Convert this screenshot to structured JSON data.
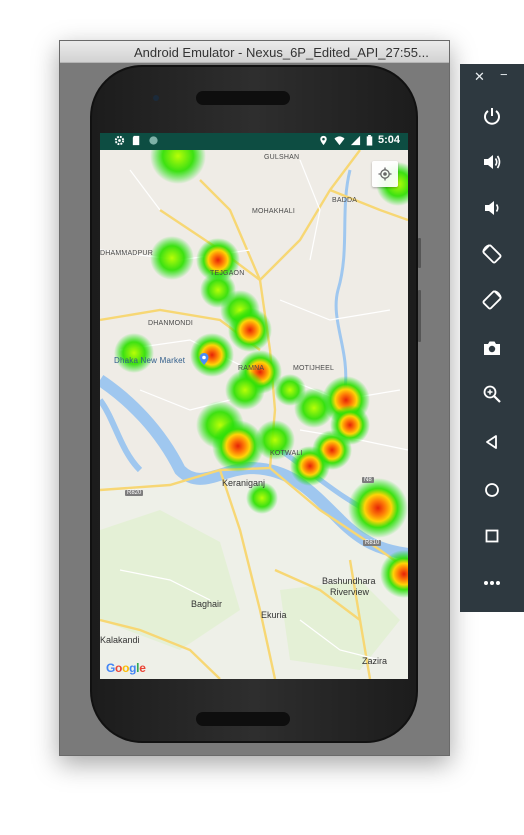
{
  "window": {
    "title": "Android Emulator - Nexus_6P_Edited_API_27:55..."
  },
  "statusbar": {
    "time": "5:04",
    "left_icons": [
      "settings-icon",
      "sd-card-icon",
      "circle-icon"
    ],
    "right_icons": [
      "location-pin-icon",
      "wifi-icon",
      "signal-icon",
      "battery-icon"
    ]
  },
  "map": {
    "labels": {
      "gulshan": "GULSHAN",
      "mohakhali": "MOHAKHALI",
      "badda": "BADDA",
      "dhammadpur": "DHAMMADPUR",
      "tejgaon": "TEJGAON",
      "dhanmondi": "DHANMONDI",
      "dhaka_new_market": "Dhaka New Market",
      "ramna": "RAMNA",
      "motijheel": "MOTIJHEEL",
      "kotwali": "KOTWALI",
      "keraniganj": "Keraniganj",
      "baghair": "Baghair",
      "ekuria": "Ekuria",
      "bashundhara_1": "Bashundhara",
      "bashundhara_2": "Riverview",
      "kalakandi": "Kalakandi",
      "zazira": "Zazira"
    },
    "road_badges": {
      "n8": "N8",
      "r820": "R820",
      "r810": "R810"
    },
    "attribution": "Google"
  },
  "side_panel": {
    "close": "✕",
    "minimize": "−",
    "buttons": [
      "power-icon",
      "volume-up-icon",
      "volume-down-icon",
      "rotate-left-icon",
      "rotate-right-icon",
      "camera-icon",
      "zoom-icon",
      "back-icon",
      "home-icon",
      "overview-icon",
      "more-icon"
    ]
  },
  "colors": {
    "statusbar": "#0d4d42",
    "panel": "#2e3940",
    "heat_low": "#00e000",
    "heat_mid": "#ffd400",
    "heat_high": "#e51c00",
    "water": "#9fc7ef"
  }
}
